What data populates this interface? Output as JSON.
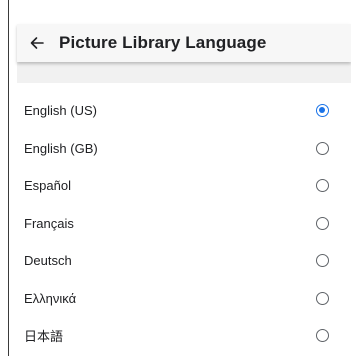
{
  "header": {
    "title": "Picture Library Language",
    "back_icon": "arrow-left-icon"
  },
  "colors": {
    "accent": "#1a73e8",
    "radio_border": "#5f6368",
    "header_bg": "#f7f7f7",
    "text": "#202124"
  },
  "languages": [
    {
      "label": "English (US)",
      "selected": true
    },
    {
      "label": "English (GB)",
      "selected": false
    },
    {
      "label": "Español",
      "selected": false
    },
    {
      "label": "Français",
      "selected": false
    },
    {
      "label": "Deutsch",
      "selected": false
    },
    {
      "label": "Ελληνικά",
      "selected": false
    },
    {
      "label": "日本語",
      "selected": false
    }
  ]
}
